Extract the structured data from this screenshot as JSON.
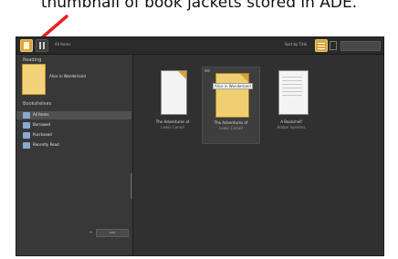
{
  "caption": "thumbnail of book jackets stored in ADE.",
  "toolbar": {
    "library_label": "Library",
    "nav_text": "All Items",
    "sort_text": "Sort by Title",
    "search_placeholder": ""
  },
  "sidebar": {
    "reading_header": "Reading",
    "current_book": "Alice in Wonderland",
    "bookshelves_header": "Bookshelves",
    "items": [
      {
        "label": "All Items"
      },
      {
        "label": "Borrowed"
      },
      {
        "label": "Purchased"
      },
      {
        "label": "Recently Read"
      }
    ],
    "add_button": "Add"
  },
  "books": [
    {
      "title": "The Adventures of",
      "author": "Lewis Carroll"
    },
    {
      "title": "The Adventures of",
      "author": "Lewis Carroll",
      "badge": "Alice in Wonderland"
    },
    {
      "title": "A Bookshelf",
      "author": "Adobe Systems"
    }
  ],
  "colors": {
    "window_bg": "#303030",
    "sidebar_bg": "#383838",
    "accent": "#d9a63f",
    "arrow": "#e8211b"
  }
}
